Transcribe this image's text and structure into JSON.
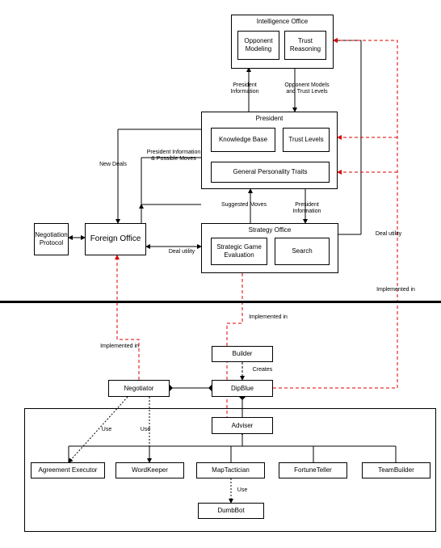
{
  "top": {
    "intelligence": {
      "title": "Intelligence Office",
      "opponent_modeling": "Opponent Modeling",
      "trust_reasoning": "Trust Reasoning"
    },
    "president": {
      "title": "President",
      "knowledge_base": "Knowledge Base",
      "trust_levels": "Trust Levels",
      "personality": "General Personality Traits"
    },
    "strategy": {
      "title": "Strategy Office",
      "strategic_eval": "Strategic Game Evaluation",
      "search": "Search"
    },
    "foreign_office": "Foreign Office",
    "negotiation_protocol": "Negotiation Protocol"
  },
  "bottom": {
    "builder": "Builder",
    "negotiator": "Negotiator",
    "dipblue": "DipBlue",
    "adviser": "Adviser",
    "agreement_executor": "Agreement Executor",
    "wordkeeper": "WordKeeper",
    "maptactician": "MapTactician",
    "fortuneteller": "FortuneTeller",
    "teambuilder": "TeamBuilder",
    "dumbbot": "DumbBot"
  },
  "labels": {
    "president_info": "President\nInformation",
    "opponent_models": "Opponent Models\nand Trust Levels",
    "new_deals": "New Deals",
    "pres_info_moves": "President Information\n& Possible Moves",
    "deal_utility": "Deal utility",
    "suggested_moves": "Suggested Moves",
    "president_info2": "President\nInformation",
    "implemented_in": "Implemented in",
    "implemented_in2": "Implemented in",
    "implemented_in3": "Implemented in",
    "creates": "Creates",
    "use": "Use"
  }
}
